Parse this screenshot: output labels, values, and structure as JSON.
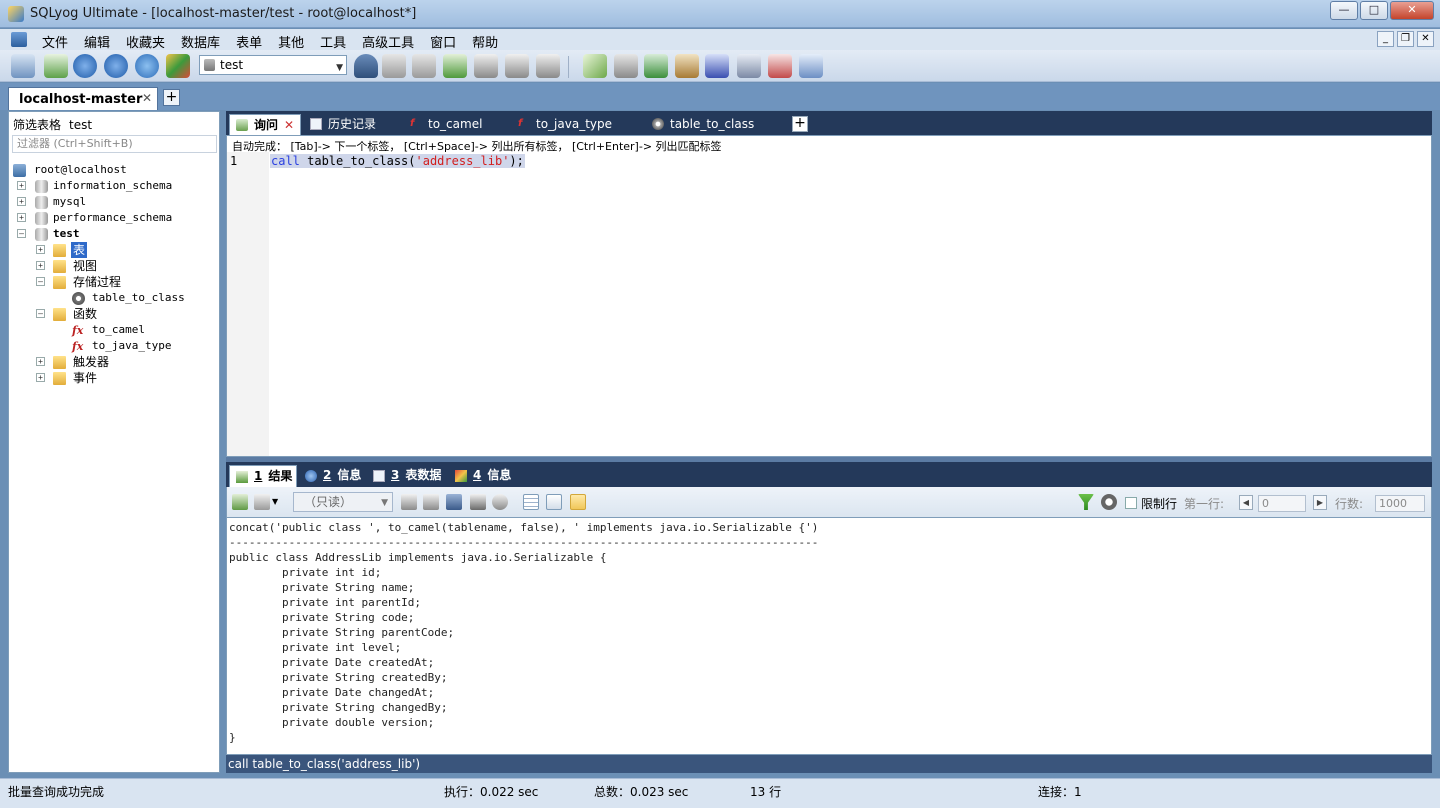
{
  "window": {
    "title": "SQLyog Ultimate - [localhost-master/test - root@localhost*]"
  },
  "menu": [
    "文件",
    "编辑",
    "收藏夹",
    "数据库",
    "表单",
    "其他",
    "工具",
    "高级工具",
    "窗口",
    "帮助"
  ],
  "toolbar": {
    "database_select": "test"
  },
  "connection_tab": {
    "label": "localhost-master"
  },
  "object_browser": {
    "filter_label": "筛选表格",
    "filter_db": "test",
    "filter_placeholder": "过滤器 (Ctrl+Shift+B)",
    "tree": {
      "root": "root@localhost",
      "dbs": [
        "information_schema",
        "mysql",
        "performance_schema",
        "test"
      ],
      "test_children": {
        "tables": "表",
        "views": "视图",
        "procedures": "存储过程",
        "procedure_item": "table_to_class",
        "functions": "函数",
        "function_items": [
          "to_camel",
          "to_java_type"
        ],
        "triggers": "触发器",
        "events": "事件"
      }
    }
  },
  "query_tabs": [
    {
      "label": "询问"
    },
    {
      "label": "历史记录"
    },
    {
      "label": "to_camel"
    },
    {
      "label": "to_java_type"
    },
    {
      "label": "table_to_class"
    }
  ],
  "editor": {
    "hint": "自动完成： [Tab]-> 下一个标签， [Ctrl+Space]-> 列出所有标签， [Ctrl+Enter]-> 列出匹配标签",
    "line_number": "1",
    "code_kw": "call",
    "code_mid": " table_to_class(",
    "code_str": "'address_lib'",
    "code_end": ");"
  },
  "result_tabs": [
    {
      "num": "1",
      "label": "结果"
    },
    {
      "num": "2",
      "label": "信息"
    },
    {
      "num": "3",
      "label": "表数据"
    },
    {
      "num": "4",
      "label": "信息"
    }
  ],
  "result_toolbar": {
    "readonly": "（只读）",
    "limit_label": "限制行",
    "first_row_label": "第一行:",
    "first_row_value": "0",
    "rows_label": "行数:",
    "rows_value": "1000"
  },
  "result_lines": [
    "concat('public class ', to_camel(tablename, false), ' implements java.io.Serializable {')",
    "-----------------------------------------------------------------------------------------",
    "public class AddressLib implements java.io.Serializable {",
    "        private int id;",
    "        private String name;",
    "        private int parentId;",
    "        private String code;",
    "        private String parentCode;",
    "        private int level;",
    "        private Date createdAt;",
    "        private String createdBy;",
    "        private Date changedAt;",
    "        private String changedBy;",
    "        private double version;",
    "}"
  ],
  "sql_status": "call table_to_class('address_lib')",
  "statusbar": {
    "message": "批量查询成功完成",
    "exec": "执行：0.022 sec",
    "total": "总数：0.023 sec",
    "rows": "13 行",
    "connection": "连接：1"
  }
}
